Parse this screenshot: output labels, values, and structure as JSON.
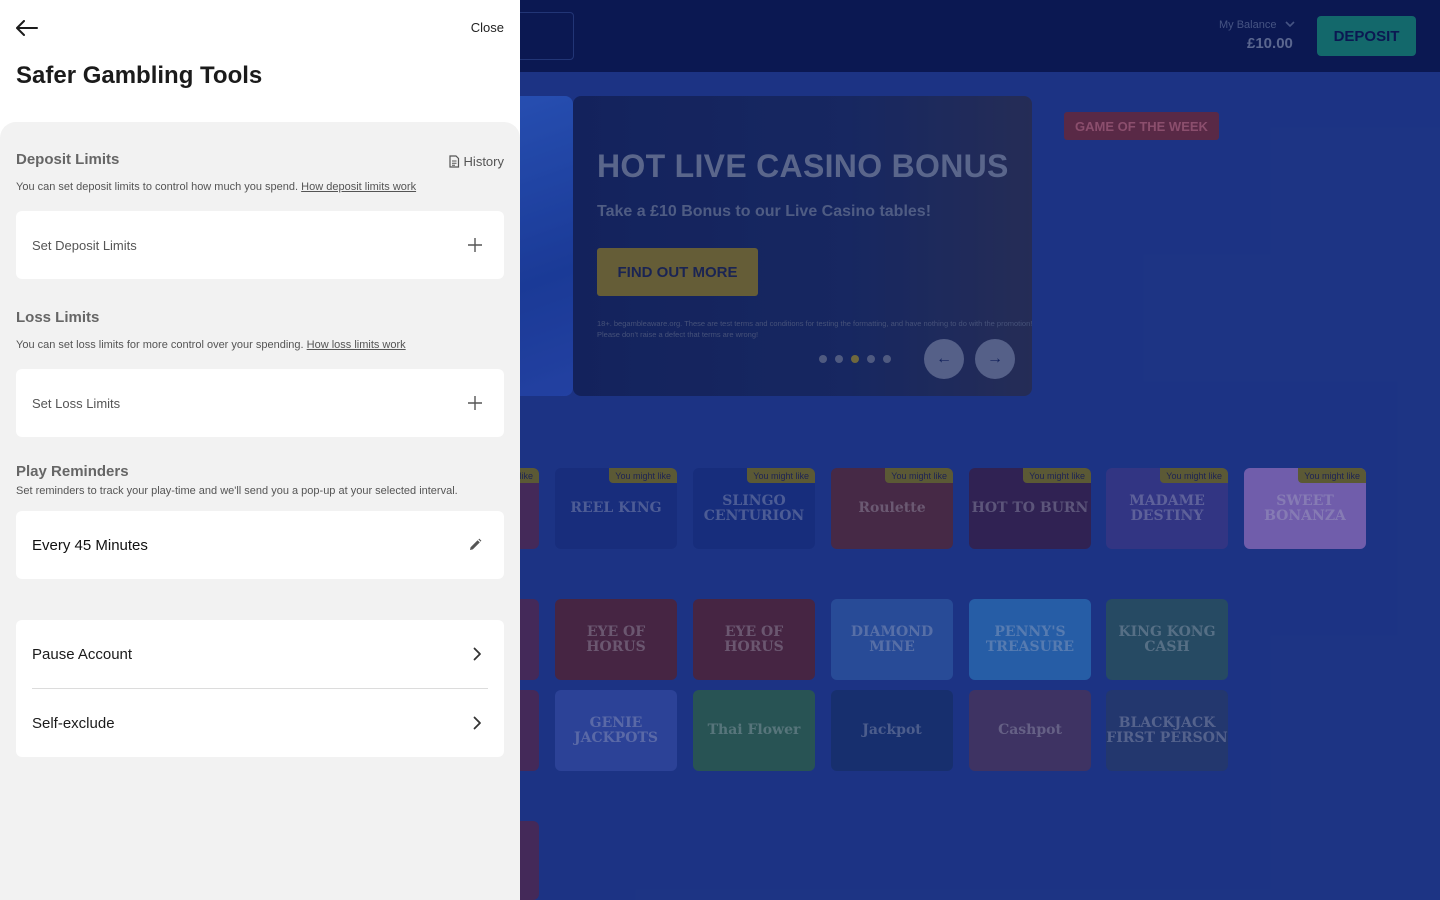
{
  "background": {
    "balance_label": "My Balance",
    "balance_value": "£10.00",
    "deposit_label": "DEPOSIT",
    "hero": {
      "title": "HOT LIVE CASINO BONUS",
      "subtitle": "Take a £10 Bonus to our Live Casino tables!",
      "button": "FIND OUT MORE",
      "terms": "18+. begambleaware.org. These are test terms and conditions for testing the formatting, and have nothing to do with the promotion! Please don't raise a defect that terms are wrong!",
      "dots": 5,
      "active_dot": 3
    },
    "game_of_week": "GAME OF THE WEEK",
    "badge_text": "You might like",
    "row1": [
      {
        "name": "",
        "badge": true,
        "color": "#5a2a5a"
      },
      {
        "name": "REEL KING",
        "badge": true,
        "color": "#16308f"
      },
      {
        "name": "SLINGO CENTURION",
        "badge": true,
        "color": "#14318f"
      },
      {
        "name": "Roulette",
        "badge": true,
        "color": "#5c2a3c"
      },
      {
        "name": "HOT TO BURN",
        "badge": true,
        "color": "#3b2050"
      },
      {
        "name": "MADAME DESTINY",
        "badge": true,
        "color": "#3e3d9a"
      },
      {
        "name": "SWEET BONANZA",
        "badge": true,
        "color": "#9d7ad8"
      }
    ],
    "row2": [
      {
        "name": "",
        "color": "#5a2a5a"
      },
      {
        "name": "EYE OF HORUS",
        "color": "#5c2438"
      },
      {
        "name": "EYE OF HORUS",
        "color": "#5c2438"
      },
      {
        "name": "DIAMOND MINE",
        "color": "#2f5fb8"
      },
      {
        "name": "PENNY'S TREASURE",
        "color": "#2b7ad0"
      },
      {
        "name": "KING KONG CASH",
        "color": "#2b5d69"
      }
    ],
    "row3": [
      {
        "name": "",
        "color": "#5a2a5a"
      },
      {
        "name": "GENIE JACKPOTS",
        "color": "#3550b8"
      },
      {
        "name": "Thai Flower",
        "color": "#2f6b52"
      },
      {
        "name": "Jackpot",
        "color": "#15347a"
      },
      {
        "name": "Cashpot",
        "color": "#503a69"
      },
      {
        "name": "BLACKJACK FIRST PERSON",
        "color": "#273f7a"
      }
    ]
  },
  "panel": {
    "close_label": "Close",
    "title": "Safer Gambling Tools",
    "history_label": "History",
    "deposit": {
      "title": "Deposit Limits",
      "desc": "You can set deposit limits to control how much you spend.",
      "link": "How deposit limits work",
      "row_label": "Set Deposit Limits"
    },
    "loss": {
      "title": "Loss Limits",
      "desc": "You can set loss limits for more control over your spending.",
      "link": "How loss limits work",
      "row_label": "Set Loss Limits"
    },
    "reminders": {
      "title": "Play Reminders",
      "desc": "Set reminders to track your play-time and we'll send you a pop-up at your selected interval.",
      "row_label": "Every 45 Minutes"
    },
    "account": {
      "pause_label": "Pause Account",
      "exclude_label": "Self-exclude"
    }
  }
}
